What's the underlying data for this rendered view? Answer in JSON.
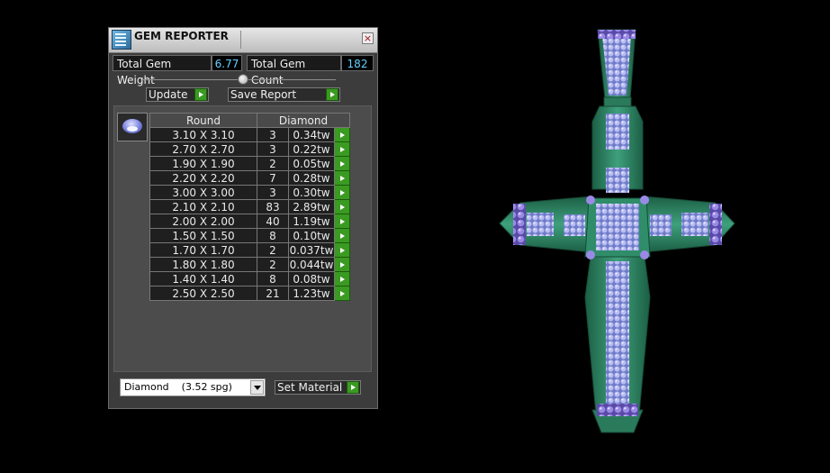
{
  "window": {
    "title": "GEM REPORTER",
    "close_label": "×"
  },
  "stats": {
    "total_weight_label": "Total Gem Weight",
    "total_weight_value": "6.77",
    "total_count_label": "Total Gem Count",
    "total_count_value": "182"
  },
  "actions": {
    "update_label": "Update",
    "save_report_label": "Save Report"
  },
  "table": {
    "shape_header": "Round",
    "material_header": "Diamond",
    "rows": [
      {
        "size": "3.10 X 3.10",
        "count": "3",
        "weight": "0.34tw"
      },
      {
        "size": "2.70 X 2.70",
        "count": "3",
        "weight": "0.22tw"
      },
      {
        "size": "1.90 X 1.90",
        "count": "2",
        "weight": "0.05tw"
      },
      {
        "size": "2.20 X 2.20",
        "count": "7",
        "weight": "0.28tw"
      },
      {
        "size": "3.00 X 3.00",
        "count": "3",
        "weight": "0.30tw"
      },
      {
        "size": "2.10 X 2.10",
        "count": "83",
        "weight": "2.89tw"
      },
      {
        "size": "2.00 X 2.00",
        "count": "40",
        "weight": "1.19tw"
      },
      {
        "size": "1.50 X 1.50",
        "count": "8",
        "weight": "0.10tw"
      },
      {
        "size": "1.70 X 1.70",
        "count": "2",
        "weight": "0.037tw"
      },
      {
        "size": "1.80 X 1.80",
        "count": "2",
        "weight": "0.044tw"
      },
      {
        "size": "1.40 X 1.40",
        "count": "8",
        "weight": "0.08tw"
      },
      {
        "size": "2.50 X 2.50",
        "count": "21",
        "weight": "1.23tw"
      }
    ]
  },
  "material": {
    "selected": "Diamond    (3.52 spg)",
    "set_label": "Set Material"
  },
  "colors": {
    "metal": "#2f8d6a",
    "gem": "#a9aef0",
    "accent_value": "#64d0ff",
    "button_green": "#3a9a22"
  },
  "icons": {
    "app": "gem-reporter-app-icon",
    "gem_preview": "round-gem-icon",
    "close": "close-icon",
    "go": "play-arrow-icon",
    "dropdown": "chevron-down-icon"
  }
}
